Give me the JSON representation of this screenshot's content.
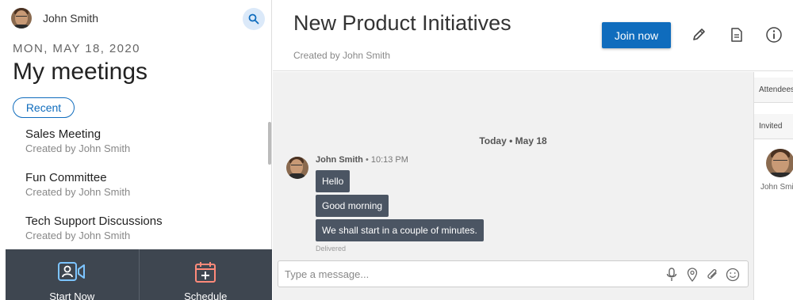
{
  "user": {
    "name": "John Smith"
  },
  "sidebar": {
    "date": "MON, MAY 18, 2020",
    "title": "My meetings",
    "filter_label": "Recent",
    "meetings": [
      {
        "name": "Sales Meeting",
        "creator": "Created by John Smith"
      },
      {
        "name": "Fun Committee",
        "creator": "Created by John Smith"
      },
      {
        "name": "Tech Support Discussions",
        "creator": "Created by John Smith"
      }
    ],
    "bottom": {
      "start_label": "Start Now",
      "schedule_label": "Schedule"
    }
  },
  "header": {
    "title": "New Product Initiatives",
    "subtitle": "Created by John Smith",
    "join_label": "Join now"
  },
  "chat": {
    "day_label": "Today • May 18",
    "sender": "John Smith",
    "time": " • 10:13 PM",
    "messages": [
      "Hello",
      "Good morning",
      "We shall start in a couple of minutes."
    ],
    "status": "Delivered",
    "composer_placeholder": "Type a message..."
  },
  "right_panel": {
    "attendees_label": "Attendees",
    "invited_label": "Invited",
    "invitee_name": "John Smith"
  },
  "colors": {
    "accent": "#0f6cbd",
    "bubble": "#4b5563",
    "bottom_bar": "#3e4650"
  },
  "icons": [
    "search-icon",
    "video-call-icon",
    "calendar-add-icon",
    "pencil-icon",
    "document-icon",
    "info-icon",
    "microphone-icon",
    "location-icon",
    "attachment-icon",
    "emoji-icon"
  ]
}
